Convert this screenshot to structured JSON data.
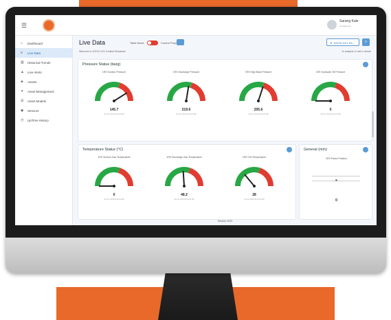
{
  "header": {
    "menu_icon": "hamburger-icon",
    "user_name": "Sarang Kale",
    "user_status": "user@email"
  },
  "sidebar": {
    "items": [
      {
        "label": "Dashboard",
        "icon": "home-icon"
      },
      {
        "label": "Live Data",
        "icon": "chart-icon"
      },
      {
        "label": "Historical Trends",
        "icon": "bars-icon"
      },
      {
        "label": "Live Alerts",
        "icon": "bell-icon"
      },
      {
        "label": "Assets",
        "icon": "cube-icon"
      },
      {
        "label": "Asset Management",
        "icon": "wrench-icon"
      },
      {
        "label": "Asset Models",
        "icon": "layers-icon"
      },
      {
        "label": "Sensors",
        "icon": "sensor-icon"
      },
      {
        "label": "UpTime History",
        "icon": "clock-icon"
      }
    ]
  },
  "main": {
    "title": "Live Data",
    "table_mode": "Table Mode",
    "control_properties": "Control Properties",
    "filter_label": "10XXX GCL Ke...",
    "welcome": "Welcome to 10XXX GCL Kodikal Shivaloam",
    "updated": "11 analysis, In last 1 minute",
    "footer": "Session 2024"
  },
  "pressure": {
    "title": "Pressure Status (barg)",
    "gauges": [
      {
        "title": "1RS Suction Pressure",
        "value": "145.7",
        "date": "Oct 22, 2024 23:10:01 PM",
        "frac": 0.82
      },
      {
        "title": "1RS Discharge Pressure",
        "value": "219.6",
        "date": "Oct 22, 2024 23:10:01 PM",
        "frac": 0.55
      },
      {
        "title": "1RS High Back Pressure",
        "value": "205.6",
        "date": "Oct 22, 2024 23:10:01 PM",
        "frac": 0.6
      },
      {
        "title": "1RS Hydraulic Oil Pressure",
        "value": "0",
        "date": "Oct 22, 2024 23:10:01 PM",
        "frac": 0.0
      }
    ]
  },
  "temperature": {
    "title": "Temperature Status (°C)",
    "gauges": [
      {
        "title": "1RS Suction Gas Temperature",
        "value": "0",
        "date": "Oct 22, 2024 23:10:01 PM",
        "frac": 0.0
      },
      {
        "title": "1RS Discharge Gas Temperature",
        "value": "48.2",
        "date": "Oct 22, 2024 23:10:01 PM",
        "frac": 0.48
      },
      {
        "title": "1RS CW Temperature",
        "value": "28",
        "date": "Oct 22, 2024 23:10:01 PM",
        "frac": 0.28
      }
    ]
  },
  "general": {
    "title": "General (mm)",
    "sub": "1RS Piston Position",
    "value": "0"
  },
  "colors": {
    "accent": "#5b9bd5",
    "orange": "#e8692a",
    "gauge_green": "#27a845",
    "gauge_red": "#e23b30"
  }
}
